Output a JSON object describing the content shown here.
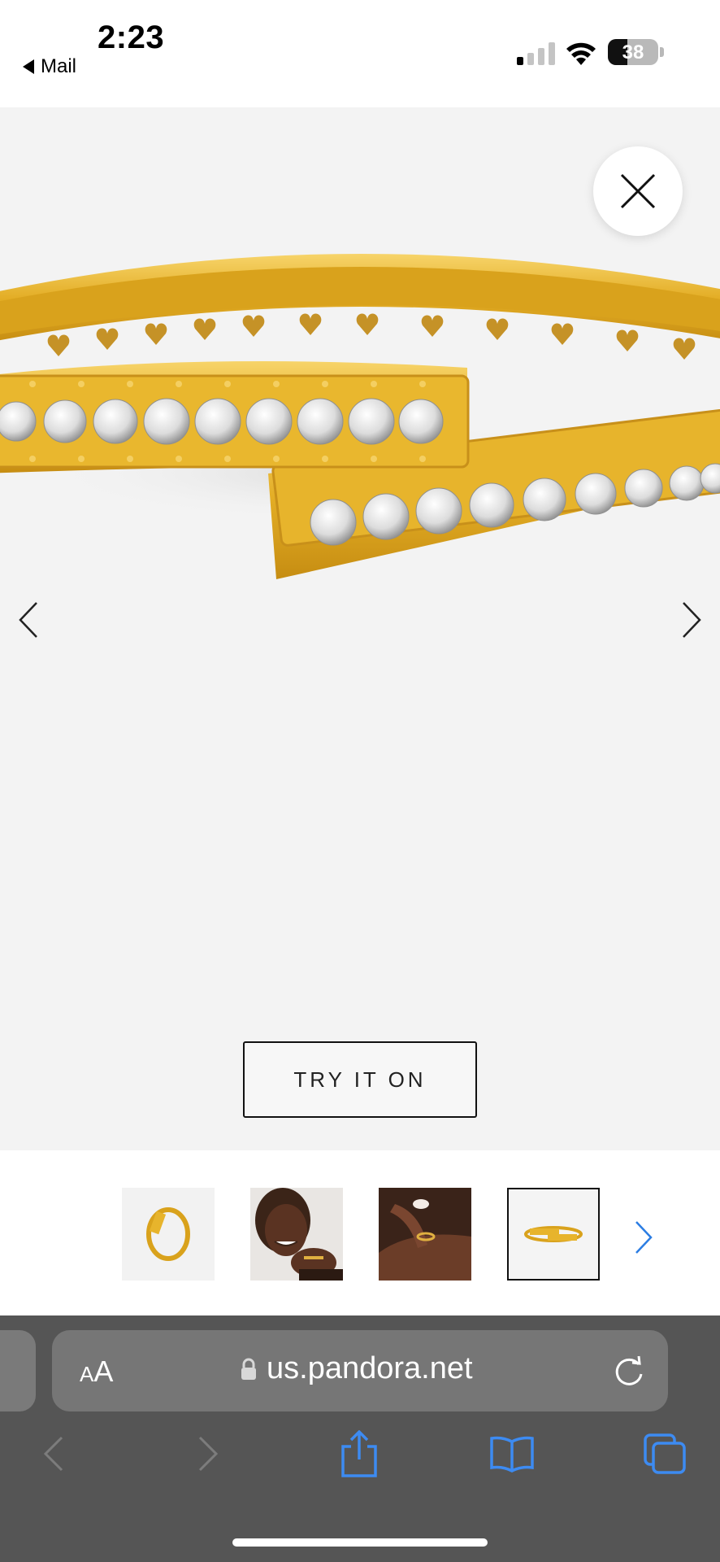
{
  "status_bar": {
    "time": "2:23",
    "back_app": "Mail",
    "battery_percent": "38",
    "battery_level": 0.38,
    "signal_bars_filled": 1,
    "icons": [
      "signal-icon",
      "wifi-icon",
      "battery-icon"
    ]
  },
  "viewer": {
    "close_icon": "close-icon",
    "prev_icon": "chevron-left-icon",
    "next_icon": "chevron-right-icon",
    "try_on_label": "TRY IT ON",
    "colors": {
      "background": "#f3f3f3",
      "gold": "#e6b52c"
    }
  },
  "thumbnails": {
    "items": [
      {
        "name": "ring-front-view",
        "selected": false
      },
      {
        "name": "model-face",
        "selected": false
      },
      {
        "name": "model-hand",
        "selected": false
      },
      {
        "name": "ring-side-view",
        "selected": true
      }
    ],
    "next_icon": "chevron-right-icon",
    "accent": "#2b7de3"
  },
  "browser": {
    "text_size_label_small": "A",
    "text_size_label_large": "A",
    "url": "us.pandora.net",
    "icons": [
      "lock-icon",
      "reload-icon",
      "back-icon",
      "forward-icon",
      "share-icon",
      "bookmarks-icon",
      "tabs-icon"
    ],
    "accent": "#3d8bf2"
  }
}
